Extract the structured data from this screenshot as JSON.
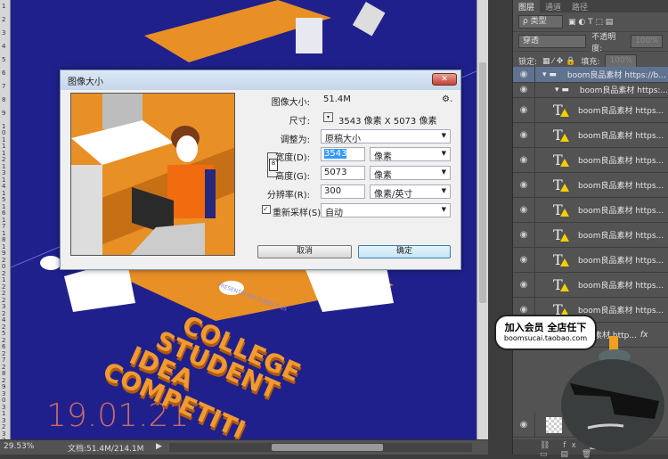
{
  "ruler": {
    "marks": [
      "1",
      "2",
      "3",
      "4",
      "5",
      "6",
      "7",
      "8",
      "9",
      "1 0",
      "1 1",
      "1 2",
      "1 3",
      "1 4",
      "1 5",
      "1 6",
      "1 7",
      "1 8",
      "1 9",
      "2 0",
      "2 1",
      "2 2",
      "2 3",
      "2 4",
      "2 5",
      "2 6",
      "2 7",
      "2 8",
      "2 9",
      "3 0",
      "3 1",
      "3 2",
      "3 3"
    ]
  },
  "canvas": {
    "bg": "#20208c",
    "accent": "#e88f25",
    "date": "19.01.21",
    "headline": [
      "COLLEGE",
      "STUDENT",
      "IDEA",
      "COMPETITI"
    ],
    "subline": "PRESENTATION SUBJECT 05",
    "small": "SUBJECT 05"
  },
  "status": {
    "zoom": "29.53%",
    "doc": "文档:51.4M/214.1M"
  },
  "dialog": {
    "title": "图像大小",
    "close": "✕",
    "image_size_label": "图像大小:",
    "image_size": "51.4M",
    "gear": "⚙.",
    "dimensions_label": "尺寸:",
    "dimensions": "3543 像素  X  5073 像素",
    "fit_label": "调整为:",
    "fit": "原稿大小",
    "width_label": "宽度(D):",
    "width": "3543",
    "width_unit": "像素",
    "height_label": "高度(G):",
    "height": "5073",
    "height_unit": "像素",
    "res_label": "分辨率(R):",
    "res": "300",
    "res_unit": "像素/英寸",
    "resample_label": "重新采样(S):",
    "resample": "自动",
    "resample_checked": true,
    "cancel": "取消",
    "ok": "确定"
  },
  "panel": {
    "tabs": [
      "图层",
      "通道",
      "路径"
    ],
    "filter": "ρ 类型",
    "blend": "穿透",
    "opacity_label": "不透明度:",
    "opacity": "100%",
    "lock_label": "锁定:",
    "fill_label": "填充:",
    "fill": "100%",
    "layers": [
      {
        "type": "group",
        "name": "boom良品素材 https://b...",
        "selected": true
      },
      {
        "type": "group",
        "name": "boom良品素材 https:..."
      },
      {
        "type": "text",
        "name": "boom良品素材 https..."
      },
      {
        "type": "text",
        "name": "boom良品素材 https..."
      },
      {
        "type": "text",
        "name": "boom良品素材 https..."
      },
      {
        "type": "text",
        "name": "boom良品素材 https..."
      },
      {
        "type": "text",
        "name": "boom良品素材 https..."
      },
      {
        "type": "text",
        "name": "boom良品素材 https..."
      },
      {
        "type": "text",
        "name": "boom良品素材 https..."
      },
      {
        "type": "text",
        "name": "boom良品素材 https..."
      },
      {
        "type": "text",
        "name": "boom良品素材 https..."
      },
      {
        "type": "text",
        "name": "良品素材 http...",
        "fx": "fx"
      }
    ]
  },
  "promo": {
    "line1": "加入会员 全店任下",
    "line2": "boomsucai.taobao.com"
  }
}
